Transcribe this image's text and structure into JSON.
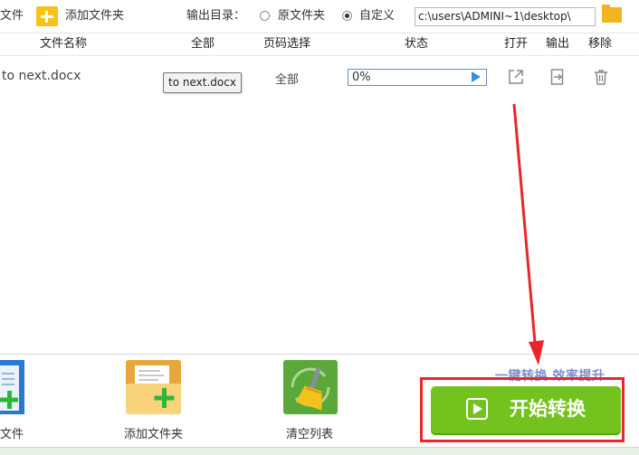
{
  "toolbar": {
    "add_file_partial": "文件",
    "add_folder_label": "添加文件夹",
    "output_dir_label": "输出目录：",
    "radio_original_label": "原文件夹",
    "radio_custom_label": "自定义",
    "radio_selected": "自定义",
    "output_path": "c:\\users\\ADMINI~1\\desktop\\"
  },
  "table": {
    "headers": {
      "filename": "文件名称",
      "total": "全部",
      "page_select": "页码选择",
      "status": "状态",
      "open": "打开",
      "output": "输出",
      "remove": "移除"
    },
    "rows": [
      {
        "filename": "to next.docx",
        "tooltip": "to next.docx",
        "page_range": "全部",
        "progress_text": "0%",
        "progress": 0
      }
    ]
  },
  "bottom": {
    "add_file_label": "文件",
    "add_folder_label": "添加文件夹",
    "clear_list_label": "清空列表",
    "slogan": "一键转换  效率提升",
    "start_button_label": "开始转换"
  },
  "colors": {
    "start_button": "#74c21d",
    "highlight_border": "#e9262b",
    "slogan": "#7a8fce",
    "folder_icon": "#f2b420"
  },
  "icons": [
    "add-folder-icon",
    "folder-browse-icon",
    "play-icon",
    "open-external-icon",
    "output-file-icon",
    "trash-icon",
    "add-file-icon",
    "clear-broom-icon",
    "start-play-icon"
  ]
}
